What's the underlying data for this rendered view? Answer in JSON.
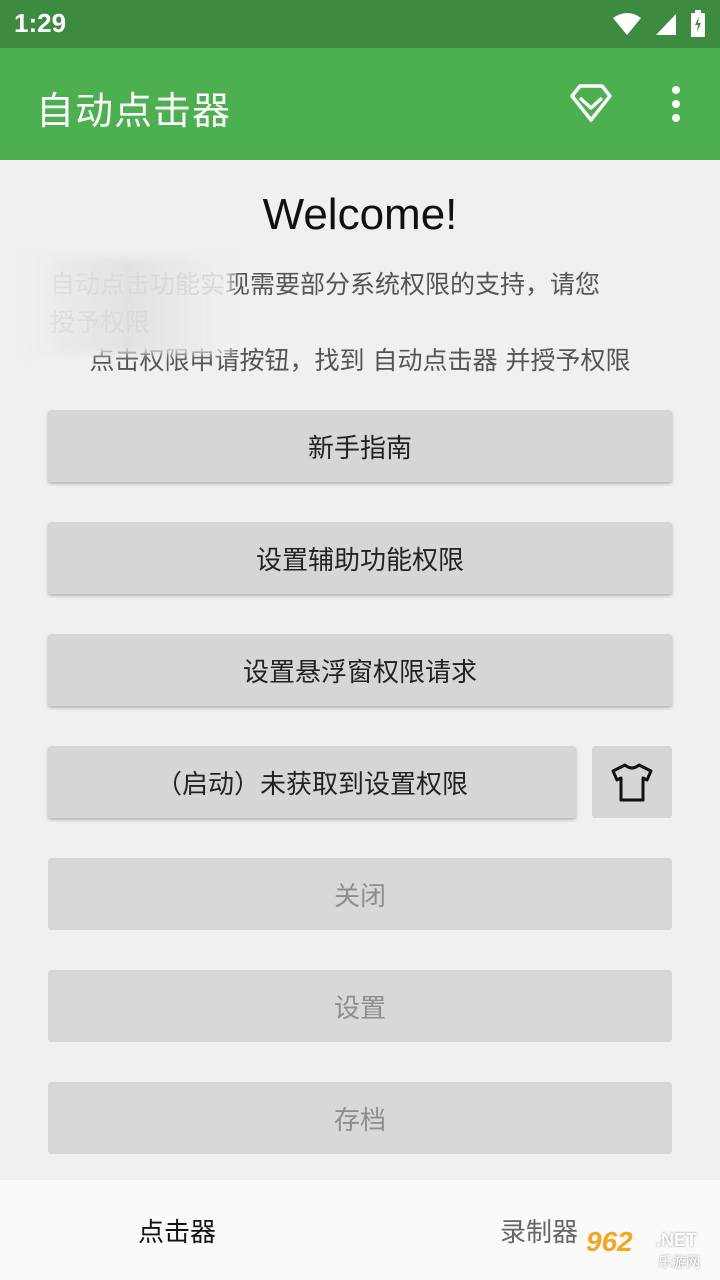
{
  "status": {
    "time": "1:29"
  },
  "app_bar": {
    "title": "自动点击器"
  },
  "main": {
    "welcome": "Welcome!",
    "desc_line1": "自动点击功能实现需要部分系统权限的支持，请您",
    "desc_line2": "授予权限",
    "desc_line3": "点击权限申请按钮，找到 自动点击器 并授予权限",
    "buttons": [
      {
        "label": "新手指南"
      },
      {
        "label": "设置辅助功能权限"
      },
      {
        "label": "设置悬浮窗权限请求"
      },
      {
        "label": "（启动）未获取到设置权限"
      },
      {
        "label": "关闭"
      },
      {
        "label": "设置"
      },
      {
        "label": "存档"
      }
    ]
  },
  "bottom_nav": {
    "items": [
      {
        "label": "点击器"
      },
      {
        "label": "录制器"
      }
    ]
  },
  "watermark": {
    "main": "962",
    "net": ".NET",
    "sub": "乐游网"
  },
  "colors": {
    "status_bar": "#3d8b40",
    "app_bar": "#4caf50",
    "button": "#d6d6d6",
    "background": "#f0f0f0"
  }
}
